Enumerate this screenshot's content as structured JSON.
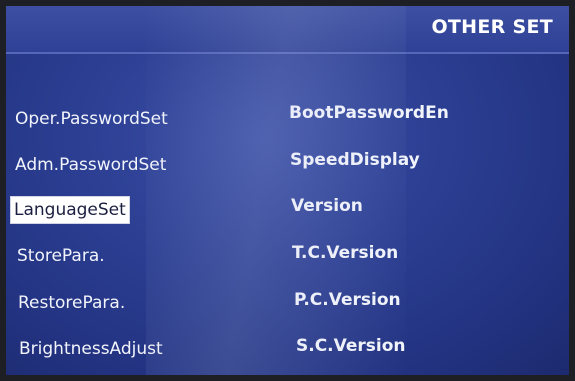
{
  "header": {
    "title": "OTHER SET"
  },
  "menu": {
    "left": [
      {
        "label": "Oper.PasswordSet"
      },
      {
        "label": "Adm.PasswordSet"
      },
      {
        "label": "LanguageSet",
        "selected": true
      },
      {
        "label": "StorePara."
      },
      {
        "label": "RestorePara."
      },
      {
        "label": "BrightnessAdjust"
      }
    ],
    "right": [
      {
        "label": "BootPasswordEn"
      },
      {
        "label": "SpeedDisplay"
      },
      {
        "label": "Version"
      },
      {
        "label": "T.C.Version"
      },
      {
        "label": "P.C.Version"
      },
      {
        "label": "S.C.Version"
      }
    ]
  },
  "colors": {
    "screen_bg": "#2c3f93",
    "text": "#f2f4fb",
    "selected_bg": "#ffffff"
  }
}
